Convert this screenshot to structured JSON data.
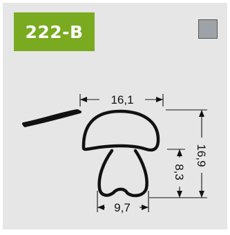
{
  "product": {
    "code": "222-B"
  },
  "swatch": {
    "color": "#9ea3a8"
  },
  "colors": {
    "badge": "#7aaa1f",
    "background": "#e6e6e6",
    "profile": "#111111"
  },
  "dimensions": {
    "top_width": "16,1",
    "total_height": "16,9",
    "stem_height": "8,3",
    "bottom_width": "9,7"
  }
}
